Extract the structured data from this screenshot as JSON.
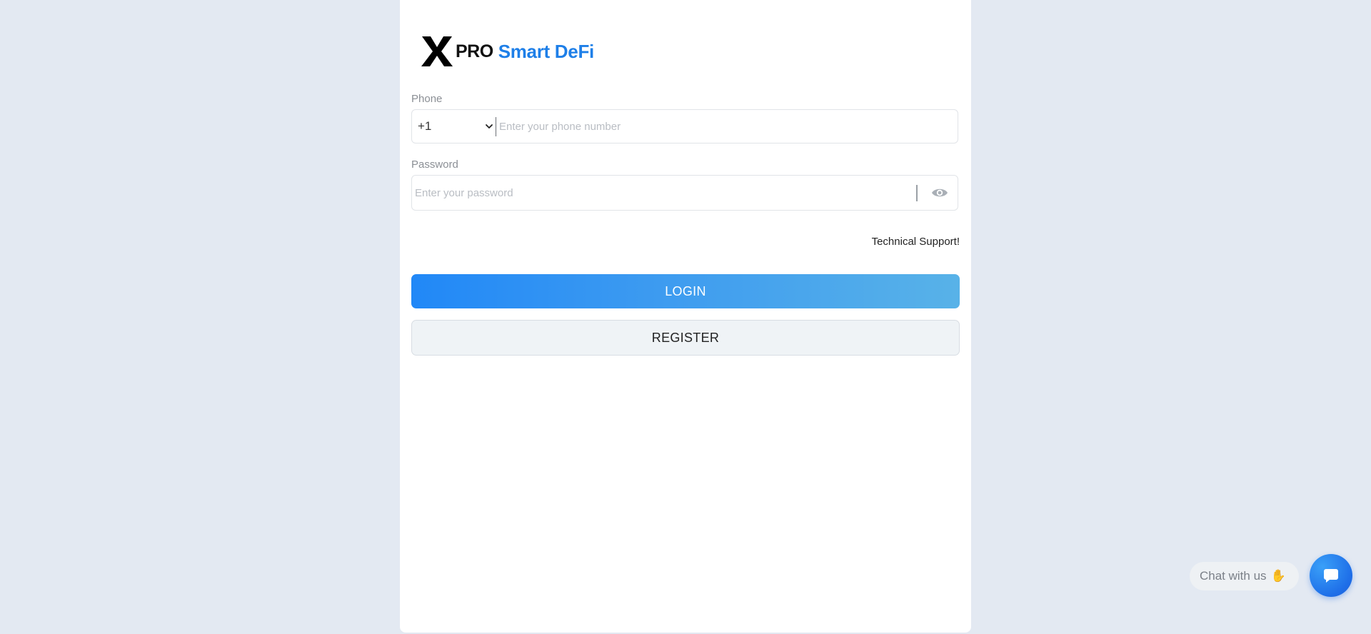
{
  "brand": {
    "pro_text": "PRO",
    "name_text": "Smart DeFi",
    "accent_color": "#1e7fe8"
  },
  "form": {
    "phone_label": "Phone",
    "country_code": "+1",
    "phone_placeholder": "Enter your phone number",
    "password_label": "Password",
    "password_placeholder": "Enter your password"
  },
  "links": {
    "support": "Technical Support!"
  },
  "buttons": {
    "login": "LOGIN",
    "register": "REGISTER"
  },
  "chat": {
    "bubble_text": "Chat with us",
    "wave_icon": "waving-hand-icon",
    "button_icon": "chat-message-icon"
  },
  "icons": {
    "logo": "x-logo-icon",
    "country_dropdown": "chevron-down-icon",
    "password_toggle": "eye-icon"
  }
}
